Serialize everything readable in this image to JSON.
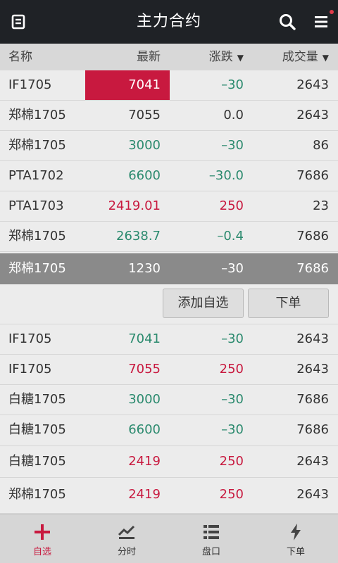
{
  "topbar": {
    "title": "主力合约"
  },
  "header": {
    "name": "名称",
    "price": "最新",
    "change": "涨跌",
    "volume": "成交量"
  },
  "rows": [
    {
      "name": "IF1705",
      "price": "7041",
      "change": "–30",
      "volume": "2643"
    },
    {
      "name": "郑棉1705",
      "price": "7055",
      "change": "0.0",
      "volume": "2643"
    },
    {
      "name": "郑棉1705",
      "price": "3000",
      "change": "–30",
      "volume": "86"
    },
    {
      "name": "PTA1702",
      "price": "6600",
      "change": "–30.0",
      "volume": "7686"
    },
    {
      "name": "PTA1703",
      "price": "2419.01",
      "change": "250",
      "volume": "23"
    },
    {
      "name": "郑棉1705",
      "price": "2638.7",
      "change": "–0.4",
      "volume": "7686"
    },
    {
      "name": "郑棉1705",
      "price": "1230",
      "change": "–30",
      "volume": "7686"
    }
  ],
  "actions": {
    "add_watch": "添加自选",
    "place_order": "下单"
  },
  "rows2": [
    {
      "name": "IF1705",
      "price": "7041",
      "change": "–30",
      "volume": "2643"
    },
    {
      "name": "IF1705",
      "price": "7055",
      "change": "250",
      "volume": "2643"
    },
    {
      "name": "白糖1705",
      "price": "3000",
      "change": "–30",
      "volume": "7686"
    },
    {
      "name": "白糖1705",
      "price": "6600",
      "change": "–30",
      "volume": "7686"
    },
    {
      "name": "白糖1705",
      "price": "2419",
      "change": "250",
      "volume": "2643"
    },
    {
      "name": "郑棉1705",
      "price": "2419",
      "change": "250",
      "volume": "2643"
    }
  ],
  "tabs": [
    {
      "label": "自选",
      "icon": "plus-icon"
    },
    {
      "label": "分时",
      "icon": "chart-icon"
    },
    {
      "label": "盘口",
      "icon": "list-icon"
    },
    {
      "label": "下单",
      "icon": "bolt-icon"
    }
  ],
  "colors": {
    "up": "#c8193f",
    "down": "#2b8a6e",
    "topbar": "#1f2226",
    "selected_row": "#8a8a8a"
  }
}
